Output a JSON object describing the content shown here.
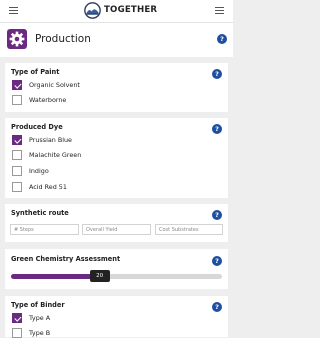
{
  "app": {
    "brand": "TOGETHER"
  },
  "header": {
    "title": "Production",
    "help": "?"
  },
  "sections": {
    "paint_type": {
      "title": "Type of Paint",
      "options": [
        {
          "label": "Organic Solvent",
          "checked": true
        },
        {
          "label": "Waterborne",
          "checked": false
        }
      ]
    },
    "produced_dye": {
      "title": "Produced Dye",
      "options": [
        {
          "label": "Prussian Blue",
          "checked": true
        },
        {
          "label": "Malachite Green",
          "checked": false
        },
        {
          "label": "Indigo",
          "checked": false
        },
        {
          "label": "Acid Red 51",
          "checked": false
        }
      ]
    },
    "synthetic_route": {
      "title": "Synthetic route",
      "fields": [
        {
          "placeholder": "# Steps"
        },
        {
          "placeholder": "Overall Yield"
        },
        {
          "placeholder": "Cost Substrates"
        }
      ]
    },
    "green_chemistry": {
      "title": "Green Chemistry Assessment",
      "value": 20,
      "max": 100
    },
    "binder_type": {
      "title": "Type of Binder",
      "options": [
        {
          "label": "Type A",
          "checked": true
        },
        {
          "label": "Type B",
          "checked": false
        }
      ]
    }
  },
  "colors": {
    "accent": "#6b2a82",
    "help": "#1e4fa0"
  }
}
